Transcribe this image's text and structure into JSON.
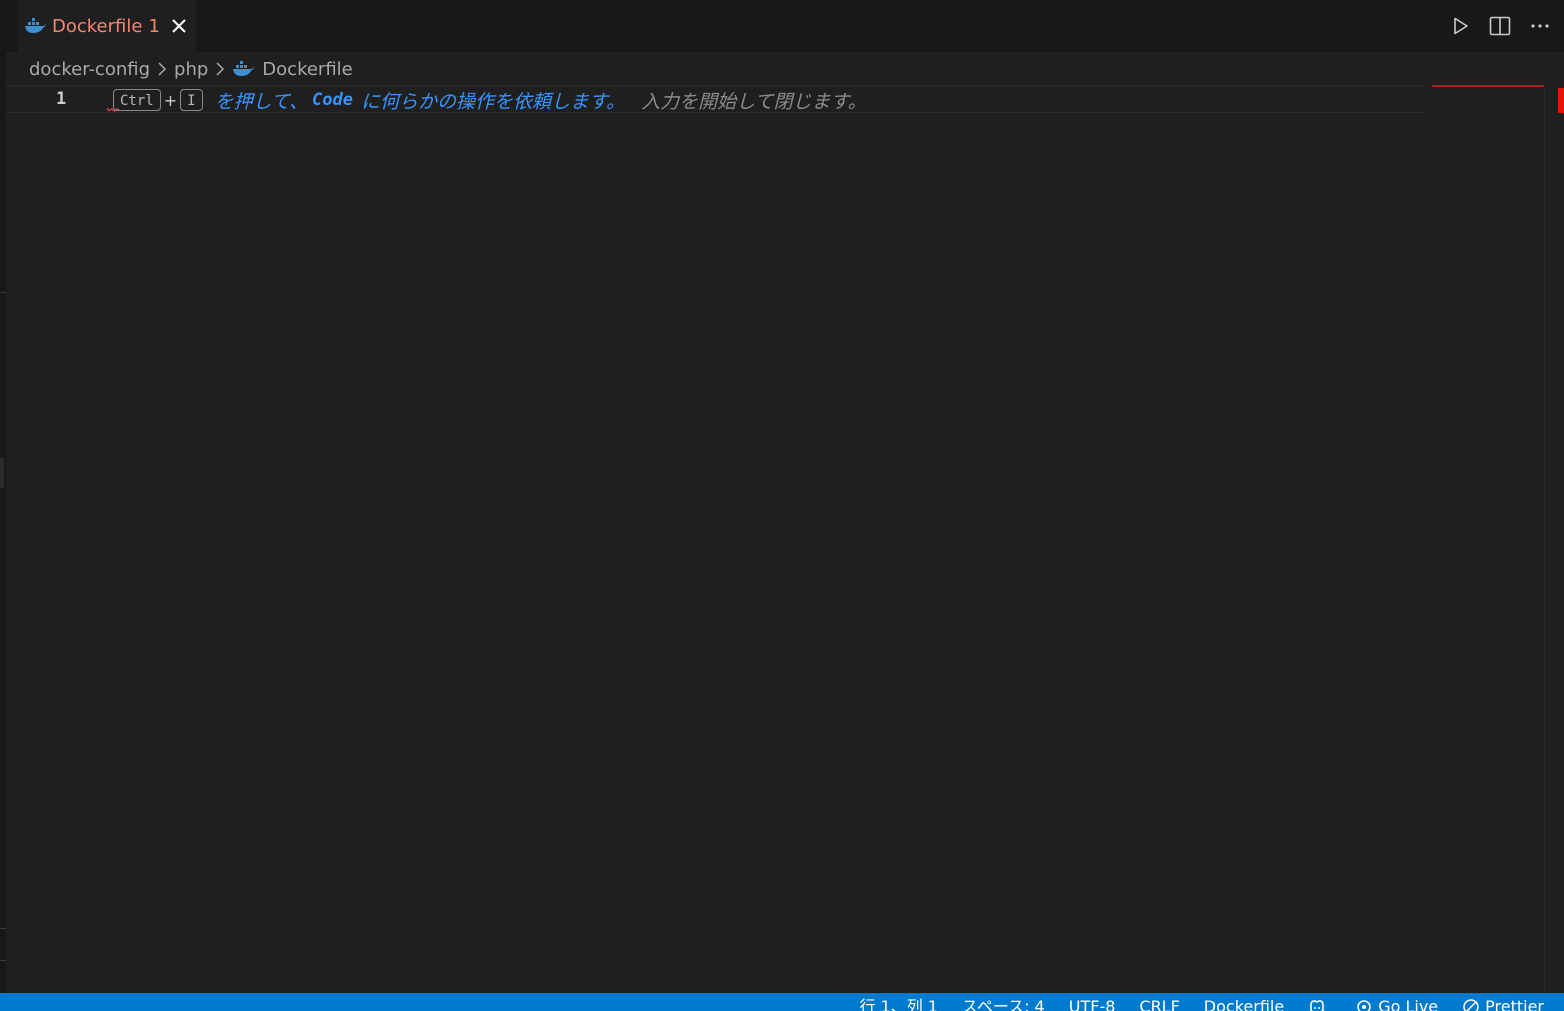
{
  "tab": {
    "label": "Dockerfile",
    "problem_count": "1"
  },
  "breadcrumb": {
    "items": [
      "docker-config",
      "php",
      "Dockerfile"
    ]
  },
  "editor": {
    "line_number": "1",
    "hint": {
      "key1": "Ctrl",
      "plus": "+",
      "key2": "I",
      "text_before": "を押して、",
      "code_word": "Code",
      "text_after": "に何らかの操作を依頼します。",
      "dismiss": "入力を開始して閉じます。"
    }
  },
  "status": {
    "position": "行 1、列 1",
    "indent": "スペース: 4",
    "encoding": "UTF-8",
    "eol": "CRLF",
    "language": "Dockerfile",
    "go_live": "Go Live",
    "prettier": "Prettier"
  },
  "colors": {
    "accent": "#007acc",
    "error_tab": "#f48771",
    "hint": "#3794ff",
    "editor_bg": "#1f1f1f"
  }
}
